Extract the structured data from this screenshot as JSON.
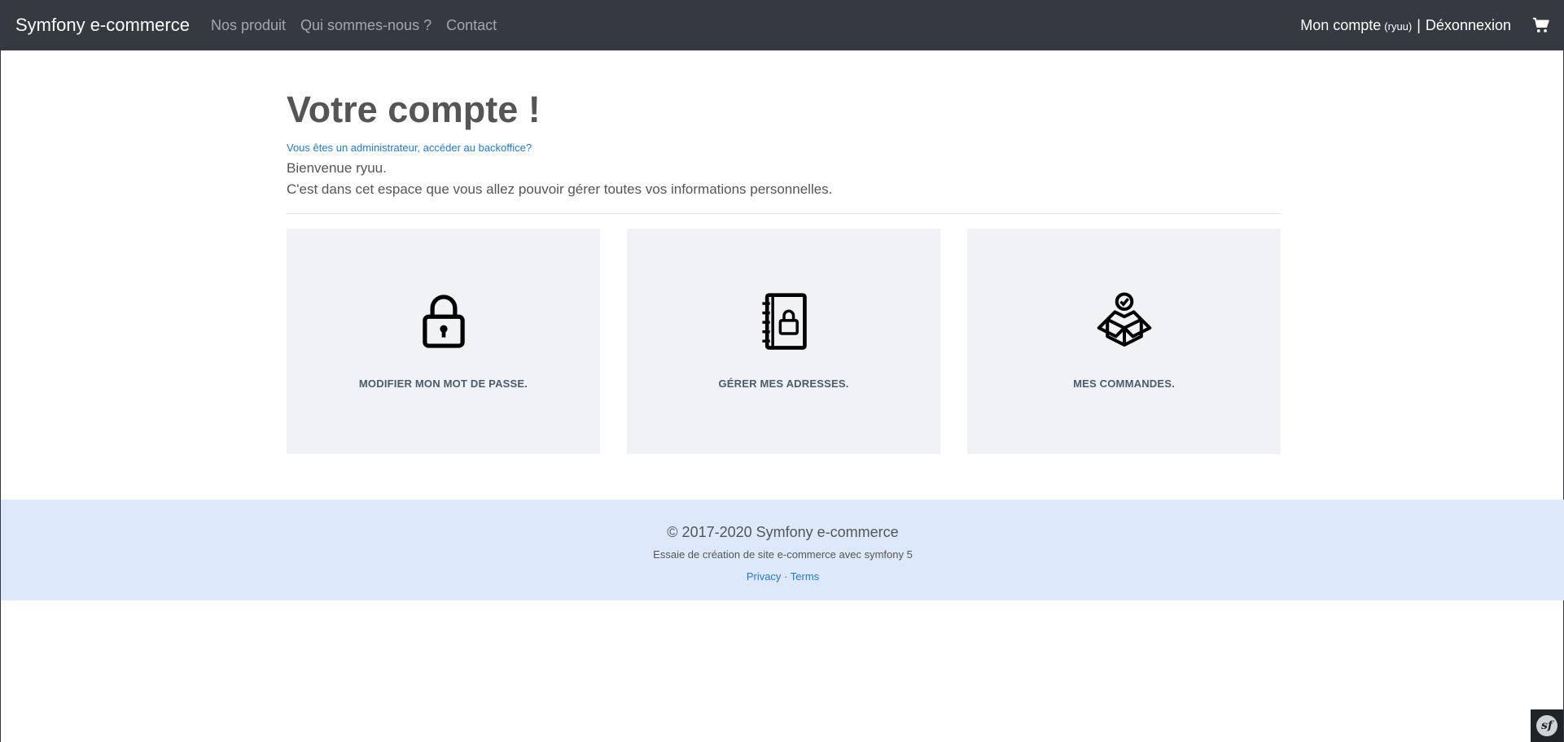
{
  "navbar": {
    "brand": "Symfony e-commerce",
    "links": [
      "Nos produit",
      "Qui sommes-nous ?",
      "Contact"
    ],
    "account_label": "Mon compte",
    "account_user": "(ryuu)",
    "separator": "|",
    "logout_label": "Déxonnexion",
    "cart_icon": "shopping-cart-icon"
  },
  "main": {
    "title": "Votre compte !",
    "admin_link": "Vous êtes un administrateur, accéder au backoffice?",
    "welcome_line1": "Bienvenue ryuu.",
    "welcome_line2": "C'est dans cet espace que vous allez pouvoir gérer toutes vos informations personnelles.",
    "cards": [
      {
        "icon": "lock-icon",
        "label": "MODIFIER MON MOT DE PASSE."
      },
      {
        "icon": "address-book-icon",
        "label": "GÉRER MES ADRESSES."
      },
      {
        "icon": "package-box-icon",
        "label": "MES COMMANDES."
      }
    ]
  },
  "footer": {
    "copyright": "© 2017-2020 Symfony e-commerce",
    "tagline": "Essaie de création de site e-commerce avec symfony 5",
    "privacy": "Privacy",
    "dot": "·",
    "terms": "Terms"
  },
  "colors": {
    "navbar_bg": "#343a40",
    "link_blue": "#1e7ad6",
    "card_bg": "#f0f2f5",
    "footer_bg": "#dde8fb"
  }
}
